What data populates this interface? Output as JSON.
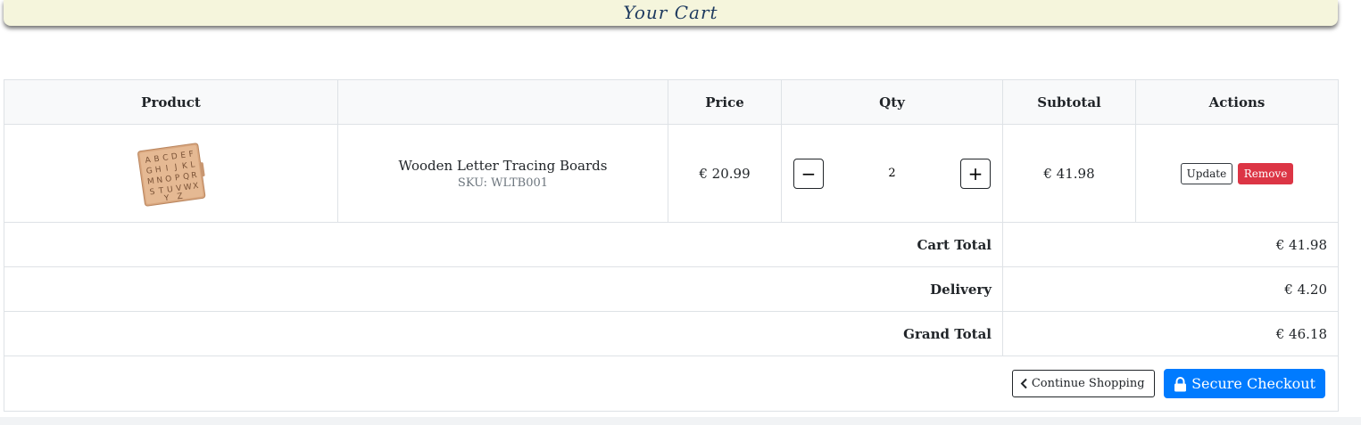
{
  "page": {
    "title": "Your Cart"
  },
  "table": {
    "headers": {
      "product": "Product",
      "name": "",
      "price": "Price",
      "qty": "Qty",
      "subtotal": "Subtotal",
      "actions": "Actions"
    }
  },
  "items": [
    {
      "name": "Wooden Letter Tracing Boards",
      "sku": "SKU: WLTB001",
      "price": "€ 20.99",
      "qty": "2",
      "subtotal": "€ 41.98",
      "decrement_label": "−",
      "increment_label": "+",
      "update_label": "Update",
      "remove_label": "Remove",
      "image_icon": "wooden-alphabet-board-image"
    }
  ],
  "totals": {
    "cart_total_label": "Cart Total",
    "cart_total_value": "€ 41.98",
    "delivery_label": "Delivery",
    "delivery_value": "€ 4.20",
    "grand_total_label": "Grand Total",
    "grand_total_value": "€ 46.18"
  },
  "actions": {
    "continue_label": "Continue Shopping",
    "continue_icon": "chevron-left-icon",
    "checkout_label": "Secure Checkout",
    "checkout_icon": "lock-icon"
  },
  "colors": {
    "title_bar_bg": "#f5f5dc",
    "title_text": "#1e3a5f",
    "checkout_bg": "#007bff",
    "remove_bg": "#dc3545"
  }
}
